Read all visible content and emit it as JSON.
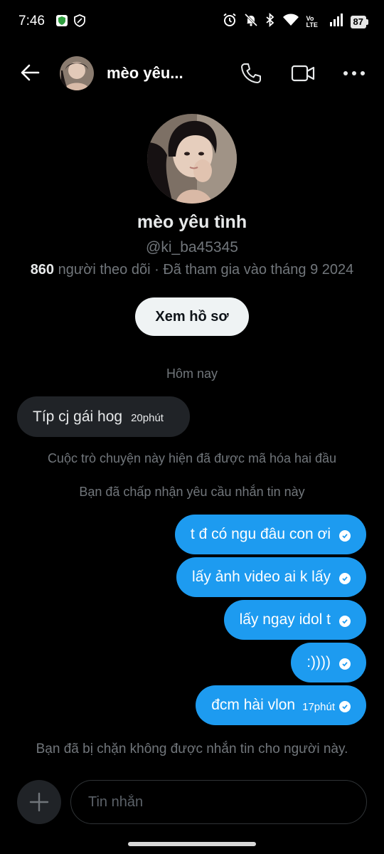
{
  "status_bar": {
    "time": "7:46",
    "battery": "87",
    "network_label": "Vo LTE"
  },
  "header": {
    "name": "mèo yêu...",
    "icons": [
      "back-arrow-icon",
      "phone-icon",
      "video-camera-icon",
      "more-icon"
    ]
  },
  "profile": {
    "name": "mèo yêu tình",
    "handle": "@ki_ba45345",
    "followers_count": "860",
    "followers_text": " người theo dõi · Đã tham gia vào tháng 9 2024",
    "view_profile_label": "Xem hồ sơ"
  },
  "conversation": {
    "date_separator": "Hôm nay",
    "incoming": {
      "text": "Típ cj gái hog",
      "time": "20phút"
    },
    "system_encrypted": "Cuộc trò chuyện này hiện đã được mã hóa hai đầu",
    "system_accepted": "Bạn đã chấp nhận yêu cầu nhắn tin này",
    "outgoing": [
      {
        "text": "t đ có ngu đâu con ơi",
        "time": ""
      },
      {
        "text": "lấy ảnh video ai k lấy",
        "time": ""
      },
      {
        "text": "lấy ngay idol t",
        "time": ""
      },
      {
        "text": ":))))",
        "time": ""
      },
      {
        "text": "đcm hài vlon",
        "time": "17phút"
      }
    ],
    "blocked_notice": "Bạn đã bị chặn không được nhắn tin cho người này."
  },
  "composer": {
    "placeholder": "Tin nhắn"
  },
  "colors": {
    "background": "#000000",
    "outgoing_bubble": "#1d9bf0",
    "incoming_bubble": "#202327",
    "muted_text": "#71767b"
  }
}
